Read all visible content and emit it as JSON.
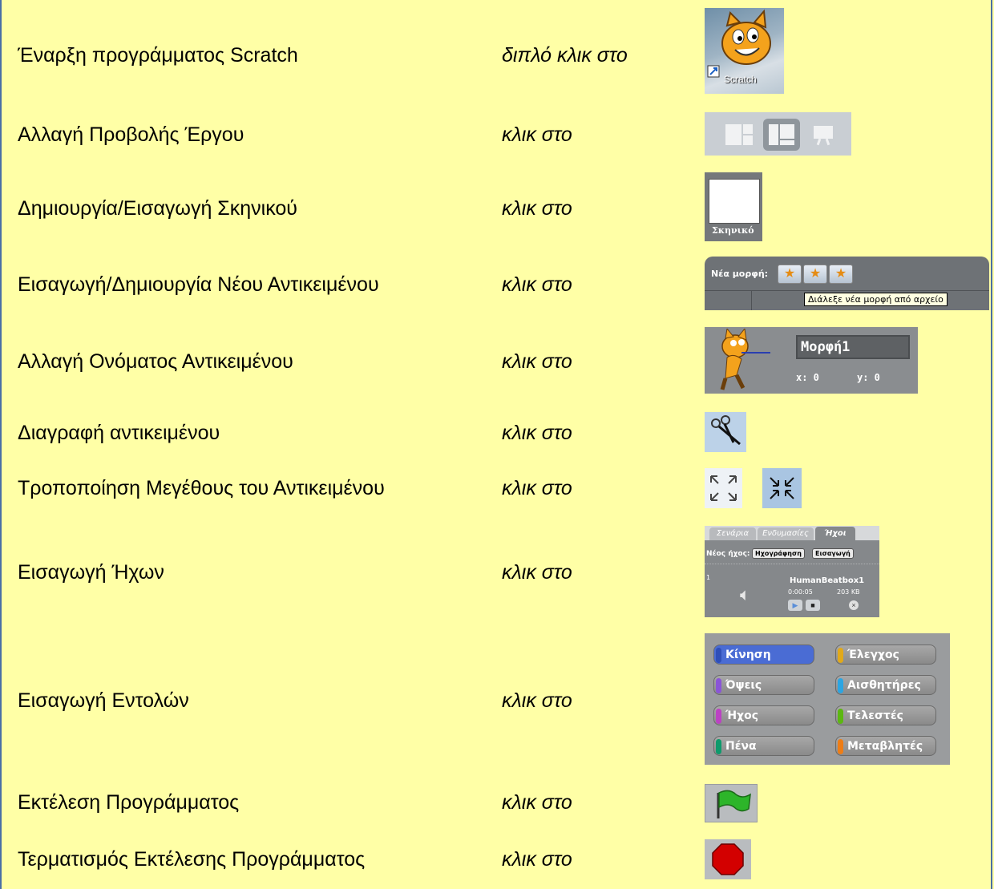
{
  "rows": [
    {
      "label": "Έναρξη προγράμματος Scratch",
      "action": "διπλό κλικ στο"
    },
    {
      "label": "Αλλαγή Προβολής Έργου",
      "action": "κλικ στο"
    },
    {
      "label": "Δημιουργία/Εισαγωγή Σκηνικού",
      "action": "κλικ στο"
    },
    {
      "label": "Εισαγωγή/Δημιουργία Νέου Αντικειμένου",
      "action": "κλικ στο"
    },
    {
      "label": "Αλλαγή Ονόματος Αντικειμένου",
      "action": "κλικ στο"
    },
    {
      "label": "Διαγραφή αντικειμένου",
      "action": "κλικ στο"
    },
    {
      "label": "Τροποποίηση Μεγέθους του Αντικειμένου",
      "action": "κλικ στο"
    },
    {
      "label": "Εισαγωγή Ήχων",
      "action": "κλικ στο"
    },
    {
      "label": "Εισαγωγή Εντολών",
      "action": "κλικ στο"
    },
    {
      "label": "Εκτέλεση Προγράμματος",
      "action": "κλικ στο"
    },
    {
      "label": "Τερματισμός Εκτέλεσης Προγράμματος",
      "action": "κλικ στο"
    }
  ],
  "icons": {
    "scratch_shortcut_label": "Scratch",
    "stage_label": "Σκηνικό",
    "new_sprite_label": "Νέα μορφή:",
    "new_sprite_tooltip": "Διάλεξε νέα μορφή από αρχείο",
    "sprite_name": "Μορφή1",
    "sprite_x": "x: 0",
    "sprite_y": "y: 0",
    "sound_tabs": [
      "Σενάρια",
      "Ενδυμασίες",
      "Ήχοι"
    ],
    "new_sound_label": "Νέος ήχος:",
    "record_button": "Ηχογράφηση",
    "import_button": "Εισαγωγή",
    "sound_index": "1",
    "sound_name": "HumanBeatbox1",
    "sound_duration": "0:00:05",
    "sound_size": "203 KB",
    "categories": [
      {
        "label": "Κίνηση",
        "color": "#4a6cd4"
      },
      {
        "label": "Έλεγχος",
        "color": "#e1a91a"
      },
      {
        "label": "Όψεις",
        "color": "#8a55d7"
      },
      {
        "label": "Αισθητήρες",
        "color": "#2ca5e2"
      },
      {
        "label": "Ήχος",
        "color": "#bb42c3"
      },
      {
        "label": "Τελεστές",
        "color": "#5cb712"
      },
      {
        "label": "Πένα",
        "color": "#0e9a6c"
      },
      {
        "label": "Μεταβλητές",
        "color": "#ee7d16"
      }
    ]
  }
}
